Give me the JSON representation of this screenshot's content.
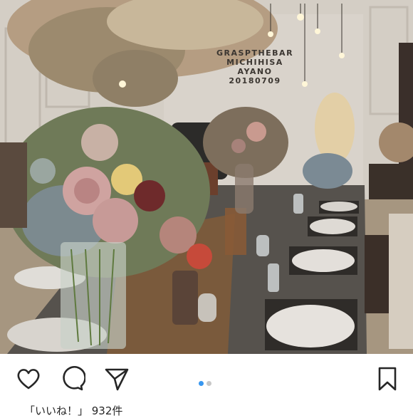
{
  "post": {
    "wall_text_lines": [
      "GRASPTHEBAR",
      "MICHIHISA",
      "AYANO",
      "20180709"
    ],
    "image_alt": "Wedding banquet table decorated with dried flower arrangements"
  },
  "actions": {
    "like_icon": "heart-icon",
    "comment_icon": "comment-icon",
    "share_icon": "paper-plane-icon",
    "save_icon": "bookmark-icon"
  },
  "carousel": {
    "count": 2,
    "active": 1,
    "active_color": "#3897f0",
    "inactive_color": "#c7c7c7"
  },
  "likes_text": "「いいね！」 932件",
  "colors": {
    "icon": "#262626",
    "background": "#ffffff"
  }
}
